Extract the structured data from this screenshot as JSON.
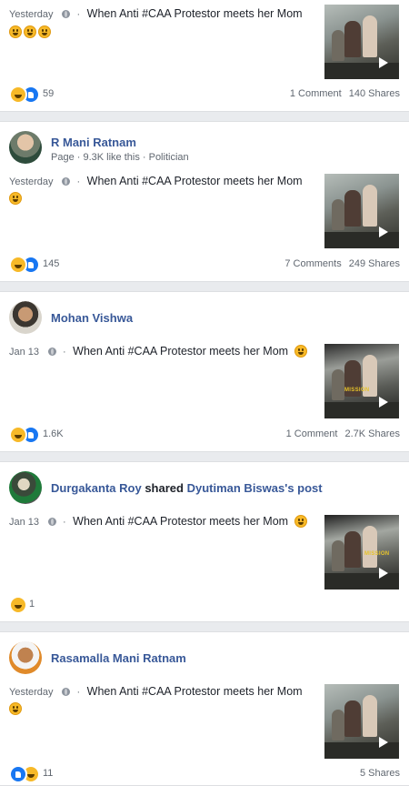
{
  "posts": [
    {
      "author": "",
      "time": "Yesterday",
      "text": "When Anti #CAA Protestor meets her Mom",
      "reaction_count": "59",
      "comments": "1 Comment",
      "shares": "140 Shares"
    },
    {
      "author": "R Mani Ratnam",
      "subtitle": "Page · 9.3K like this · Politician",
      "time": "Yesterday",
      "text": "When Anti #CAA Protestor meets her Mom",
      "reaction_count": "145",
      "comments": "7 Comments",
      "shares": "249 Shares"
    },
    {
      "author": "Mohan Vishwa",
      "time": "Jan 13",
      "text": "When Anti #CAA Protestor meets her Mom",
      "reaction_count": "1.6K",
      "comments": "1 Comment",
      "shares": "2.7K Shares"
    },
    {
      "author": "Durgakanta Roy",
      "shared_word": "shared",
      "shared_from": "Dyutiman Biswas's post",
      "time": "Jan 13",
      "text": "When Anti #CAA Protestor meets her Mom",
      "reaction_count": "1",
      "comments": "",
      "shares": ""
    },
    {
      "author": "Rasamalla Mani Ratnam",
      "time": "Yesterday",
      "text": "When Anti #CAA Protestor meets her Mom",
      "reaction_count": "11",
      "comments": "",
      "shares": "5 Shares"
    }
  ],
  "thumbnail_watermark": "MISSION",
  "colors": {
    "link_blue": "#385898",
    "like_blue": "#1877f2",
    "haha_yellow": "#f7b928",
    "feed_bg": "#e9ebee"
  }
}
